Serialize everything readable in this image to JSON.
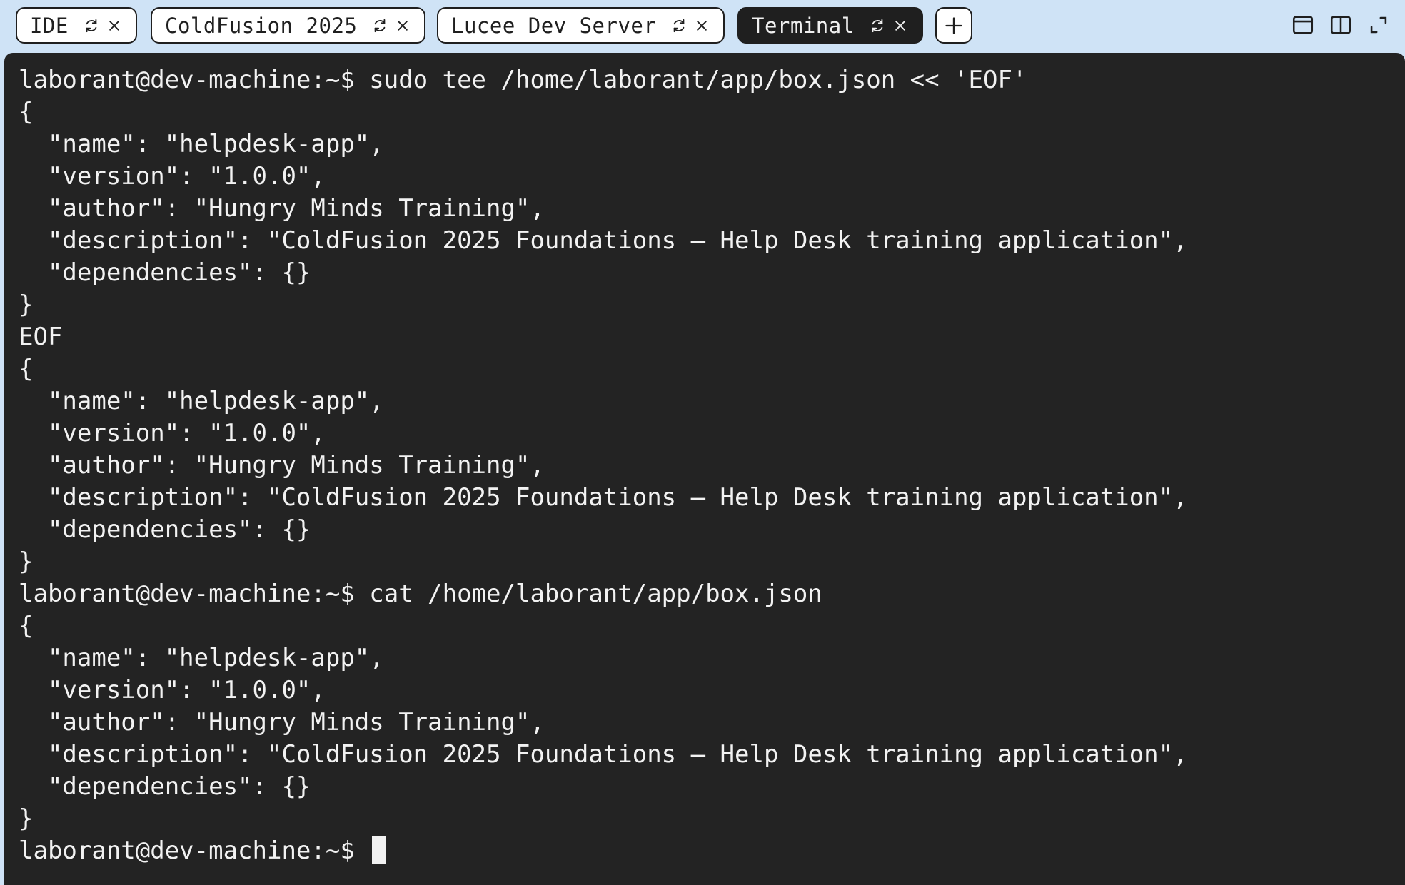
{
  "tabs": [
    {
      "label": "IDE",
      "active": false
    },
    {
      "label": "ColdFusion 2025",
      "active": false
    },
    {
      "label": "Lucee Dev Server",
      "active": false
    },
    {
      "label": "Terminal",
      "active": true
    }
  ],
  "icons": {
    "refresh": "refresh-icon",
    "close": "close-icon",
    "add": "plus-icon",
    "window": "window-icon",
    "split": "split-view-icon",
    "expand": "expand-icon"
  },
  "terminal": {
    "lines": [
      "laborant@dev-machine:~$ sudo tee /home/laborant/app/box.json << 'EOF'",
      "{",
      "  \"name\": \"helpdesk-app\",",
      "  \"version\": \"1.0.0\",",
      "  \"author\": \"Hungry Minds Training\",",
      "  \"description\": \"ColdFusion 2025 Foundations — Help Desk training application\",",
      "  \"dependencies\": {}",
      "}",
      "EOF",
      "{",
      "  \"name\": \"helpdesk-app\",",
      "  \"version\": \"1.0.0\",",
      "  \"author\": \"Hungry Minds Training\",",
      "  \"description\": \"ColdFusion 2025 Foundations — Help Desk training application\",",
      "  \"dependencies\": {}",
      "}",
      "laborant@dev-machine:~$ cat /home/laborant/app/box.json",
      "{",
      "  \"name\": \"helpdesk-app\",",
      "  \"version\": \"1.0.0\",",
      "  \"author\": \"Hungry Minds Training\",",
      "  \"description\": \"ColdFusion 2025 Foundations — Help Desk training application\",",
      "  \"dependencies\": {}",
      "}"
    ],
    "prompt": "laborant@dev-machine:~$ "
  },
  "colors": {
    "tabbar_bg": "#cfe3f6",
    "terminal_bg": "#232323",
    "terminal_fg": "#f2f2f2",
    "active_tab_bg": "#1f1f1f"
  }
}
